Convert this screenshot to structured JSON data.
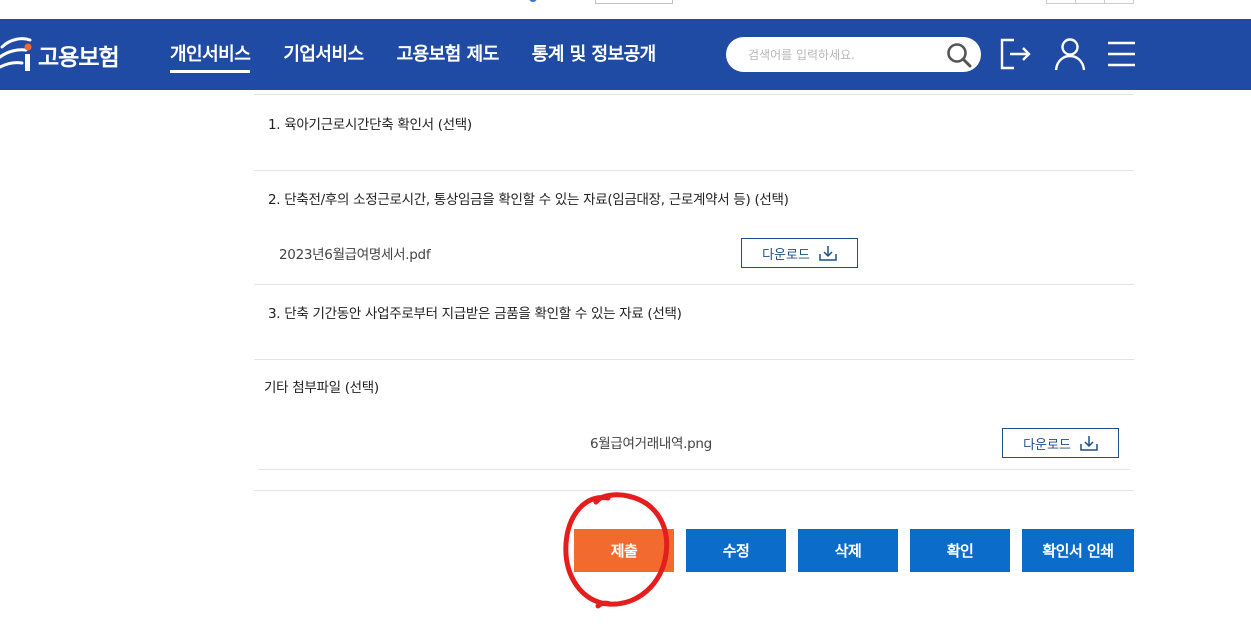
{
  "header": {
    "logo_text": "고용보험",
    "nav": [
      {
        "label": "개인서비스",
        "active": true
      },
      {
        "label": "기업서비스",
        "active": false
      },
      {
        "label": "고용보험 제도",
        "active": false
      },
      {
        "label": "통계 및 정보공개",
        "active": false
      }
    ],
    "search_placeholder": "검색어를 입력하세요.",
    "icons": [
      "search-icon",
      "logout-icon",
      "user-icon",
      "menu-icon"
    ]
  },
  "sections": [
    {
      "title": "1. 육아기근로시간단축 확인서 (선택)",
      "file": null,
      "download_label": null
    },
    {
      "title": "2. 단축전/후의 소정근로시간, 통상임금을 확인할 수 있는 자료(임금대장, 근로계약서 등) (선택)",
      "file": "2023년6월급여명세서.pdf",
      "download_label": "다운로드"
    },
    {
      "title": "3. 단축 기간동안 사업주로부터 지급받은 금품을 확인할 수 있는 자료 (선택)",
      "file": null,
      "download_label": null
    },
    {
      "title": "기타 첨부파일 (선택)",
      "file": "6월급여거래내역.png",
      "download_label": "다운로드"
    }
  ],
  "actions": {
    "submit": "제출",
    "edit": "수정",
    "delete": "삭제",
    "confirm": "확인",
    "print": "확인서 인쇄"
  },
  "colors": {
    "header_bg": "#1f4ba5",
    "submit_bg": "#f36a2e",
    "action_bg": "#0b6cc9",
    "download_border": "#1f4f8a",
    "annotation": "#e41e1e"
  }
}
